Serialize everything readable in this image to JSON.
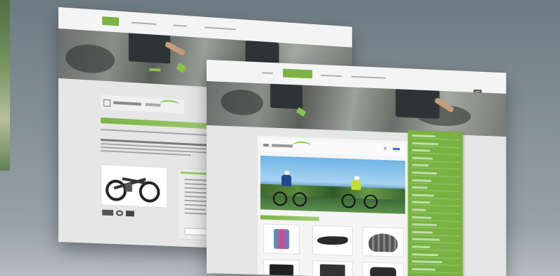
{
  "scene": {
    "background": "#7d8890",
    "accent": "#7cb342"
  },
  "back_page": {
    "nav": [
      {
        "label": "",
        "active": true
      },
      {
        "label": "",
        "active": false
      },
      {
        "label": "",
        "active": false
      },
      {
        "label": "",
        "active": false
      }
    ],
    "menu_icon": "hamburger-icon",
    "hero_image": "mountain-biker-photo",
    "logo_icon": "moblitz-logo",
    "headline": "",
    "bike_image": "e-bike-photo",
    "bike_label": "",
    "side_title": "",
    "side_button": ""
  },
  "front_page": {
    "nav": [
      {
        "label": "",
        "active": false
      },
      {
        "label": "",
        "active": true
      },
      {
        "label": "",
        "active": false
      },
      {
        "label": "",
        "active": false
      }
    ],
    "menu_icon": "hamburger-icon",
    "hero_image": "mountain-biker-photo",
    "logo_icon": "moblitz-logo",
    "close_icon": "close-icon",
    "flag_icon": "flag-icon",
    "photo": "two-cyclists-lake-photo",
    "products_title": "",
    "products": [
      {
        "icon": "cycling-kit-icon"
      },
      {
        "icon": "bike-saddle-icon"
      },
      {
        "icon": "bike-helmet-icon"
      },
      {
        "icon": "bike-bag-icon"
      },
      {
        "icon": "bike-bag-icon"
      },
      {
        "icon": "bike-accessory-icon"
      }
    ],
    "dropdown_items": [
      "",
      "",
      "",
      "",
      "",
      "",
      "",
      "",
      "",
      "",
      "",
      "",
      "",
      "",
      "",
      "",
      "",
      "",
      ""
    ]
  }
}
